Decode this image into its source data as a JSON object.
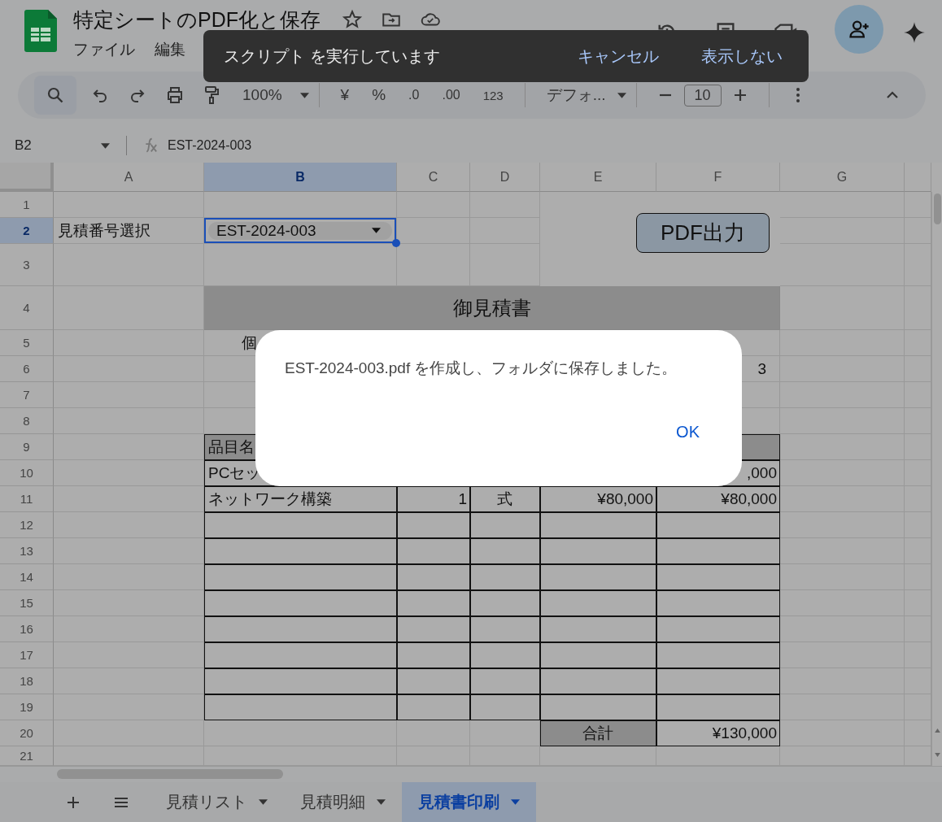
{
  "document": {
    "title": "特定シートのPDF化と保存"
  },
  "menu": [
    "ファイル",
    "編集"
  ],
  "snackbar": {
    "message": "スクリプト を実行しています",
    "actions": [
      "キャンセル",
      "表示しない"
    ]
  },
  "toolbar": {
    "zoom": "100%",
    "currency": "¥",
    "percent": "%",
    "decimal_decrease": ".0",
    "decimal_increase": ".00",
    "number_format": "123",
    "font": "デフォ...",
    "font_size": "10"
  },
  "formula_bar": {
    "cell_ref": "B2",
    "value": "EST-2024-003"
  },
  "sheet": {
    "columns": [
      {
        "label": "A",
        "selected": false
      },
      {
        "label": "B",
        "selected": true
      },
      {
        "label": "C",
        "selected": false
      },
      {
        "label": "D",
        "selected": false
      },
      {
        "label": "E",
        "selected": false
      },
      {
        "label": "F",
        "selected": false
      },
      {
        "label": "G",
        "selected": false
      }
    ],
    "rows": [
      {
        "number": "1",
        "selected": false,
        "cells": []
      },
      {
        "number": "2",
        "selected": true,
        "cells": [
          {
            "kind": "label",
            "text": "見積番号選択"
          },
          {
            "kind": "dropdown",
            "text": "EST-2024-003"
          }
        ]
      },
      {
        "number": "3",
        "selected": false,
        "cells": []
      },
      {
        "number": "4",
        "selected": false,
        "cells": [
          {},
          {
            "kind": "title"
          }
        ]
      },
      {
        "number": "5",
        "selected": false,
        "cells": [
          {},
          {
            "kind": "indent",
            "text": "個"
          }
        ]
      },
      {
        "number": "6",
        "selected": false,
        "cells": [
          {},
          {},
          {},
          {},
          {},
          {
            "kind": "right",
            "text": "3"
          }
        ]
      },
      {
        "number": "7",
        "selected": false,
        "cells": []
      },
      {
        "number": "8",
        "selected": false,
        "cells": []
      },
      {
        "number": "9",
        "selected": false,
        "cells": [
          {},
          {
            "kind": "th",
            "text": "品目名"
          },
          {
            "kind": "th"
          },
          {
            "kind": "th"
          },
          {
            "kind": "th"
          },
          {
            "kind": "th"
          }
        ]
      },
      {
        "number": "10",
        "selected": false,
        "cells": [
          {},
          {
            "kind": "td",
            "text": "PCセッ"
          },
          {
            "kind": "td"
          },
          {
            "kind": "td"
          },
          {
            "kind": "td"
          },
          {
            "kind": "td-num",
            "text": ",000"
          }
        ]
      },
      {
        "number": "11",
        "selected": false,
        "cells": [
          {},
          {
            "kind": "td",
            "text": "ネットワーク構築"
          },
          {
            "kind": "td-num",
            "text": "1"
          },
          {
            "kind": "td-center",
            "text": "式"
          },
          {
            "kind": "td-num",
            "text": "¥80,000"
          },
          {
            "kind": "td-num",
            "text": "¥80,000"
          }
        ]
      },
      {
        "number": "12",
        "selected": false,
        "cells": [
          {},
          {
            "kind": "td"
          },
          {
            "kind": "td"
          },
          {
            "kind": "td"
          },
          {
            "kind": "td"
          },
          {
            "kind": "td"
          }
        ]
      },
      {
        "number": "13",
        "selected": false,
        "cells": [
          {},
          {
            "kind": "td"
          },
          {
            "kind": "td"
          },
          {
            "kind": "td"
          },
          {
            "kind": "td"
          },
          {
            "kind": "td"
          }
        ]
      },
      {
        "number": "14",
        "selected": false,
        "cells": [
          {},
          {
            "kind": "td"
          },
          {
            "kind": "td"
          },
          {
            "kind": "td"
          },
          {
            "kind": "td"
          },
          {
            "kind": "td"
          }
        ]
      },
      {
        "number": "15",
        "selected": false,
        "cells": [
          {},
          {
            "kind": "td"
          },
          {
            "kind": "td"
          },
          {
            "kind": "td"
          },
          {
            "kind": "td"
          },
          {
            "kind": "td"
          }
        ]
      },
      {
        "number": "16",
        "selected": false,
        "cells": [
          {},
          {
            "kind": "td"
          },
          {
            "kind": "td"
          },
          {
            "kind": "td"
          },
          {
            "kind": "td"
          },
          {
            "kind": "td"
          }
        ]
      },
      {
        "number": "17",
        "selected": false,
        "cells": [
          {},
          {
            "kind": "td"
          },
          {
            "kind": "td"
          },
          {
            "kind": "td"
          },
          {
            "kind": "td"
          },
          {
            "kind": "td"
          }
        ]
      },
      {
        "number": "18",
        "selected": false,
        "cells": [
          {},
          {
            "kind": "td"
          },
          {
            "kind": "td"
          },
          {
            "kind": "td"
          },
          {
            "kind": "td"
          },
          {
            "kind": "td"
          }
        ]
      },
      {
        "number": "19",
        "selected": false,
        "cells": [
          {},
          {
            "kind": "td"
          },
          {
            "kind": "td"
          },
          {
            "kind": "td"
          },
          {
            "kind": "td"
          },
          {
            "kind": "td"
          }
        ]
      },
      {
        "number": "20",
        "selected": false,
        "cells": [
          {},
          {},
          {},
          {},
          {
            "kind": "total",
            "text": "合計"
          },
          {
            "kind": "td-num",
            "text": "¥130,000"
          }
        ]
      },
      {
        "number": "21",
        "selected": false,
        "cells": []
      }
    ],
    "merged_title": "御見積書",
    "drawing_button": {
      "label": "PDF出力"
    }
  },
  "dialog": {
    "message": "EST-2024-003.pdf を作成し、フォルダに保存しました。",
    "button": "OK"
  },
  "sheet_tabs": [
    {
      "label": "見積リスト",
      "selected": false
    },
    {
      "label": "見積明細",
      "selected": false
    },
    {
      "label": "見積書印刷",
      "selected": true
    }
  ]
}
